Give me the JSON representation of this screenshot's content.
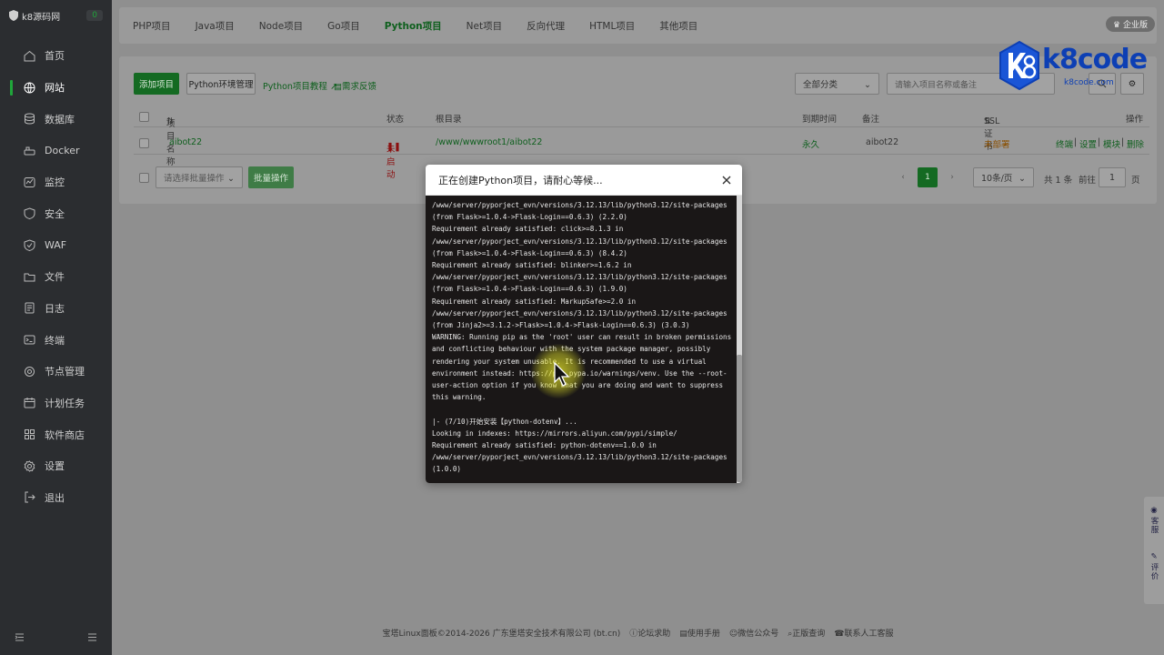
{
  "sidebar": {
    "logo_text": "k8源码网",
    "count": "0",
    "items": [
      {
        "label": "首页",
        "icon": "home-icon"
      },
      {
        "label": "网站",
        "icon": "globe-icon",
        "active": true
      },
      {
        "label": "数据库",
        "icon": "database-icon"
      },
      {
        "label": "Docker",
        "icon": "docker-icon"
      },
      {
        "label": "监控",
        "icon": "monitor-icon"
      },
      {
        "label": "安全",
        "icon": "shield-icon"
      },
      {
        "label": "WAF",
        "icon": "waf-icon"
      },
      {
        "label": "文件",
        "icon": "folder-icon"
      },
      {
        "label": "日志",
        "icon": "log-icon"
      },
      {
        "label": "终端",
        "icon": "terminal-icon"
      },
      {
        "label": "节点管理",
        "icon": "node-icon"
      },
      {
        "label": "计划任务",
        "icon": "calendar-icon"
      },
      {
        "label": "软件商店",
        "icon": "store-icon"
      },
      {
        "label": "设置",
        "icon": "gear-icon"
      },
      {
        "label": "退出",
        "icon": "logout-icon"
      }
    ]
  },
  "tabs": [
    "PHP项目",
    "Java项目",
    "Node项目",
    "Go项目",
    "Python项目",
    "Net项目",
    "反向代理",
    "HTML项目",
    "其他项目"
  ],
  "active_tab": "Python项目",
  "enterprise_label": "企业版",
  "toolbar": {
    "add_label": "添加项目",
    "env_label": "Python环境管理",
    "tutorial_label": "Python项目教程",
    "feedback_label": "需求反馈",
    "category_label": "全部分类",
    "search_placeholder": "请输入项目名称或备注"
  },
  "table": {
    "headers": {
      "name": "项目名称",
      "status": "状态",
      "root": "根目录",
      "expire": "到期时间",
      "note": "备注",
      "ssl": "SSL证书",
      "ops": "操作"
    },
    "rows": [
      {
        "name": "aibot22",
        "status": "未启动",
        "root": "/www/wwwroot1/aibot22",
        "expire": "永久",
        "note": "aibot22",
        "ssl": "未部署",
        "ops": [
          "终端",
          "设置",
          "模块",
          "删除"
        ]
      }
    ]
  },
  "batch": {
    "select_placeholder": "请选择批量操作",
    "button_label": "批量操作"
  },
  "pagination": {
    "current": "1",
    "per_page": "10条/页",
    "total": "共 1 条",
    "goto_label": "前往",
    "goto_value": "1",
    "page_suffix": "页"
  },
  "float_tools": [
    "客服",
    "评价"
  ],
  "footer": {
    "copyright": "宝塔Linux面板©2014-2026 广东堡塔安全技术有限公司 (bt.cn)",
    "links": [
      "论坛求助",
      "使用手册",
      "微信公众号",
      "正版查询",
      "联系人工客服"
    ]
  },
  "watermark": {
    "brand": "k8code",
    "url": "k8code.com"
  },
  "modal": {
    "title": "正在创建Python项目，请耐心等候...",
    "console_lines": [
      "/www/server/pyporject_evn/versions/3.12.13/lib/python3.12/site-packages",
      "(from Flask>=1.0.4->Flask-Login==0.6.3) (2.2.0)",
      "Requirement already satisfied: click>=8.1.3 in",
      "/www/server/pyporject_evn/versions/3.12.13/lib/python3.12/site-packages",
      "(from Flask>=1.0.4->Flask-Login==0.6.3) (8.4.2)",
      "Requirement already satisfied: blinker>=1.6.2 in",
      "/www/server/pyporject_evn/versions/3.12.13/lib/python3.12/site-packages",
      "(from Flask>=1.0.4->Flask-Login==0.6.3) (1.9.0)",
      "Requirement already satisfied: MarkupSafe>=2.0 in",
      "/www/server/pyporject_evn/versions/3.12.13/lib/python3.12/site-packages",
      "(from Jinja2>=3.1.2->Flask>=1.0.4->Flask-Login==0.6.3) (3.0.3)",
      "WARNING: Running pip as the 'root' user can result in broken permissions",
      "and conflicting behaviour with the system package manager, possibly",
      "rendering your system unusable. It is recommended to use a virtual",
      "environment instead: https://pip.pypa.io/warnings/venv. Use the --root-",
      "user-action option if you know what you are doing and want to suppress",
      "this warning.",
      "",
      "|- (7/10)开始安装【python-dotenv】...",
      "Looking in indexes: https://mirrors.aliyun.com/pypi/simple/",
      "Requirement already satisfied: python-dotenv==1.0.0 in",
      "/www/server/pyporject_evn/versions/3.12.13/lib/python3.12/site-packages",
      "(1.0.0)"
    ]
  }
}
